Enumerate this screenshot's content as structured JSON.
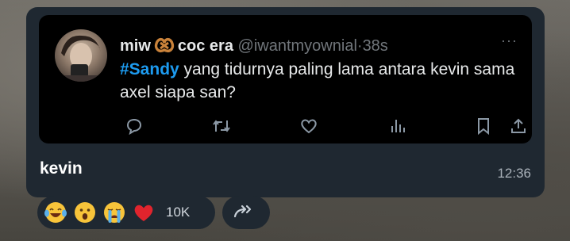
{
  "tweet": {
    "display_name": "miw",
    "name_suffix": "coc era",
    "handle": "@iwantmyownial",
    "separator": "·",
    "time_ago": "38s",
    "hashtag": "#Sandy",
    "text_body": " yang tidurnya paling lama antara kevin sama axel siapa san?",
    "more_label": "···",
    "emoji_name": "pretzel-icon",
    "actions": [
      "reply-icon",
      "retweet-icon",
      "like-icon",
      "views-icon",
      "bookmark-icon",
      "share-icon"
    ]
  },
  "message": {
    "caption": "kevin",
    "timestamp": "12:36"
  },
  "reactions": {
    "emojis": [
      "laughing-tears-emoji",
      "surprised-emoji",
      "crying-emoji",
      "red-heart-emoji"
    ],
    "count": "10K"
  },
  "colors": {
    "bubble": "#1f2831",
    "tweet_bg": "#000000",
    "hashtag": "#1d9bf0",
    "muted": "#71767b"
  }
}
